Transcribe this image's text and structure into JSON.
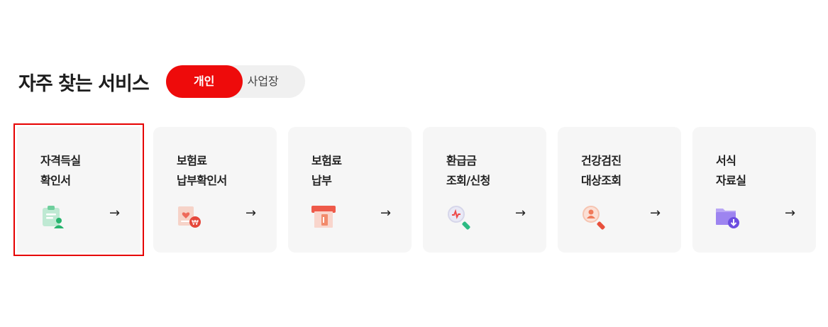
{
  "section": {
    "title": "자주 찾는 서비스",
    "toggle": {
      "active": "개인",
      "inactive": "사업장"
    }
  },
  "arrow_glyph": "→",
  "cards": [
    {
      "line1": "자격득실",
      "line2": "확인서",
      "icon": "certificate-person-icon",
      "selected": true
    },
    {
      "line1": "보험료",
      "line2": "납부확인서",
      "icon": "payment-receipt-icon",
      "selected": false
    },
    {
      "line1": "보험료",
      "line2": "납부",
      "icon": "card-payment-icon",
      "selected": false
    },
    {
      "line1": "환급금",
      "line2": "조회/신청",
      "icon": "refund-search-icon",
      "selected": false
    },
    {
      "line1": "건강검진",
      "line2": "대상조회",
      "icon": "checkup-search-icon",
      "selected": false
    },
    {
      "line1": "서식",
      "line2": "자료실",
      "icon": "folder-download-icon",
      "selected": false
    }
  ],
  "colors": {
    "accent": "#ee0b0b",
    "card_bg": "#f6f6f6",
    "toggle_bg": "#f0f0f0"
  }
}
